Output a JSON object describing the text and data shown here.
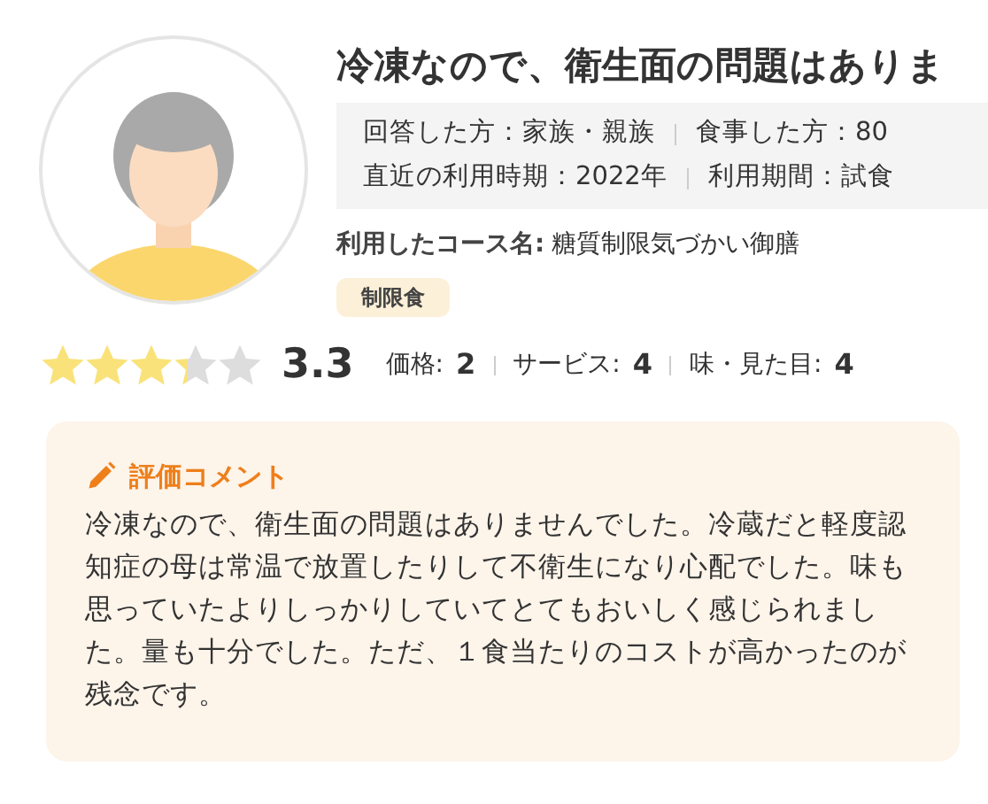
{
  "title": "冷凍なので、衛生面の問題はありま",
  "info_rows": [
    [
      "回答した方：家族・親族",
      "食事した方：80"
    ],
    [
      "直近の利用時期：2022年",
      "利用期間：試食"
    ]
  ],
  "course": {
    "label": "利用したコース名:",
    "value": "糖質制限気づかい御膳"
  },
  "tags": [
    "制限食"
  ],
  "rating": {
    "stars": 3.3,
    "score": "3.3"
  },
  "sub_ratings": [
    {
      "label": "価格:",
      "value": "2"
    },
    {
      "label": "サービス:",
      "value": "4"
    },
    {
      "label": "味・見た目:",
      "value": "4"
    }
  ],
  "comment": {
    "heading": "評価コメント",
    "text": "冷凍なので、衛生面の問題はありませんでした。冷蔵だと軽度認知症の母は常温で放置したりして不衛生になり心配でした。味も思っていたよりしっかりしていてとてもおいしく感じられました。量も十分でした。ただ、１食当たりのコストが高かったのが残念です。"
  }
}
